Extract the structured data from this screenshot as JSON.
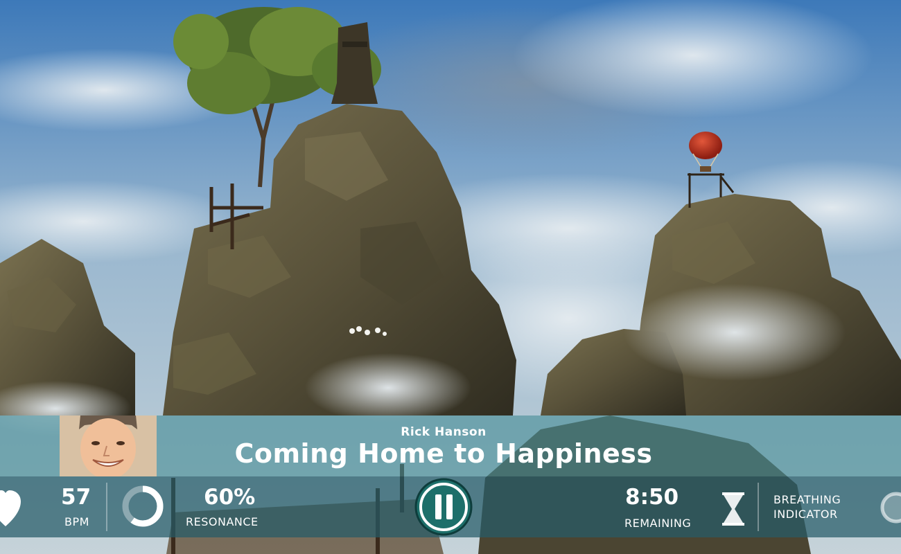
{
  "session": {
    "narrator": "Rick Hanson",
    "title": "Coming Home to Happiness"
  },
  "stats": {
    "heart_rate": {
      "value": "57",
      "label": "BPM"
    },
    "resonance": {
      "value": "60%",
      "label": "RESONANCE",
      "ring_fill": 0.6
    },
    "time": {
      "value": "8:50",
      "label": "REMAINING"
    },
    "breathing": {
      "line1": "BREATHING",
      "line2": "INDICATOR"
    }
  },
  "controls": {
    "playback_state": "playing"
  },
  "colors": {
    "hud_top": "#468c96",
    "hud_bottom": "#265c68",
    "pause_ring": "#1d6f6a",
    "balloon": "#c4301d",
    "sky": "#7ea7c8",
    "rock": "#5b5439"
  }
}
